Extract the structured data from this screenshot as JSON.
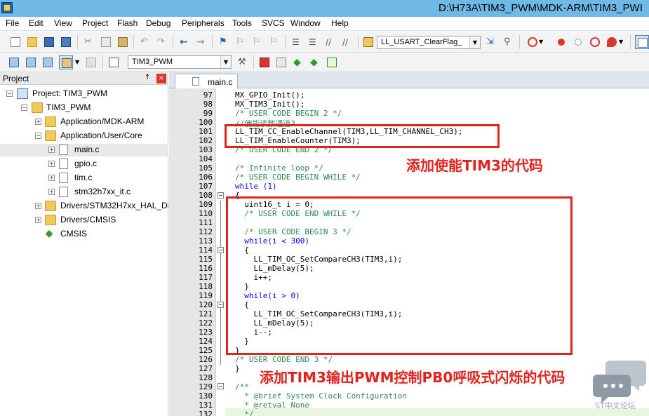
{
  "window": {
    "title": "D:\\H73A\\TIM3_PWM\\MDK-ARM\\TIM3_PWI"
  },
  "menu": [
    "File",
    "Edit",
    "View",
    "Project",
    "Flash",
    "Debug",
    "Peripherals",
    "Tools",
    "SVCS",
    "Window",
    "Help"
  ],
  "toolbar": {
    "find_combo": "LL_USART_ClearFlag_",
    "target_combo": "TIM3_PWM"
  },
  "project_pane": {
    "title": "Project",
    "pin": "↑",
    "close": "×",
    "tree": [
      {
        "label": "Project: TIM3_PWM",
        "expander": "−"
      },
      {
        "label": "TIM3_PWM",
        "expander": "−"
      },
      {
        "label": "Application/MDK-ARM",
        "expander": "+"
      },
      {
        "label": "Application/User/Core",
        "expander": "−"
      },
      {
        "label": "main.c",
        "expander": "+"
      },
      {
        "label": "gpio.c",
        "expander": "+"
      },
      {
        "label": "tim.c",
        "expander": "+"
      },
      {
        "label": "stm32h7xx_it.c",
        "expander": "+"
      },
      {
        "label": "Drivers/STM32H7xx_HAL_Dri",
        "expander": "+"
      },
      {
        "label": "Drivers/CMSIS",
        "expander": "+"
      },
      {
        "label": "CMSIS",
        "expander": ""
      }
    ]
  },
  "editor": {
    "tab": "main.c",
    "lines": [
      {
        "num": "97",
        "text": "MX_GPIO_Init();",
        "color": "#000000"
      },
      {
        "num": "98",
        "text": "MX_TIM3_Init();",
        "color": "#000000"
      },
      {
        "num": "99",
        "text": "/* USER CODE BEGIN 2 */",
        "color": "#2e8b57"
      },
      {
        "num": "100",
        "text": "//使能读数通道3",
        "color": "#2e8b57"
      },
      {
        "num": "101",
        "text": "LL_TIM_CC_EnableChannel(TIM3,LL_TIM_CHANNEL_CH3);",
        "color": "#000000"
      },
      {
        "num": "102",
        "text": "LL_TIM_EnableCounter(TIM3);",
        "color": "#000000"
      },
      {
        "num": "103",
        "text": "/* USER CODE END 2 */",
        "color": "#2e8b57"
      },
      {
        "num": "104",
        "text": "",
        "color": "#000000"
      },
      {
        "num": "105",
        "text": "/* Infinite loop */",
        "color": "#2e8b57"
      },
      {
        "num": "106",
        "text": "/* USER CODE BEGIN WHILE */",
        "color": "#2e8b57"
      },
      {
        "num": "107",
        "text": "while (1)",
        "color": "#0000ff"
      },
      {
        "num": "108",
        "text": "{",
        "color": "#000000"
      },
      {
        "num": "109",
        "text": "  uint16_t i = 0;",
        "color": "#000000"
      },
      {
        "num": "110",
        "text": "  /* USER CODE END WHILE */",
        "color": "#2e8b57"
      },
      {
        "num": "111",
        "text": "",
        "color": "#000000"
      },
      {
        "num": "112",
        "text": "  /* USER CODE BEGIN 3 */",
        "color": "#2e8b57"
      },
      {
        "num": "113",
        "text": "  while(i < 300)",
        "color": "#0000ff"
      },
      {
        "num": "114",
        "text": "  {",
        "color": "#000000"
      },
      {
        "num": "115",
        "text": "    LL_TIM_OC_SetCompareCH3(TIM3,i);",
        "color": "#000000"
      },
      {
        "num": "116",
        "text": "    LL_mDelay(5);",
        "color": "#000000"
      },
      {
        "num": "117",
        "text": "    i++;",
        "color": "#000000"
      },
      {
        "num": "118",
        "text": "  }",
        "color": "#000000"
      },
      {
        "num": "119",
        "text": "  while(i > 0)",
        "color": "#0000ff"
      },
      {
        "num": "120",
        "text": "  {",
        "color": "#000000"
      },
      {
        "num": "121",
        "text": "    LL_TIM_OC_SetCompareCH3(TIM3,i);",
        "color": "#000000"
      },
      {
        "num": "122",
        "text": "    LL_mDelay(5);",
        "color": "#000000"
      },
      {
        "num": "123",
        "text": "    i--;",
        "color": "#000000"
      },
      {
        "num": "124",
        "text": "  }",
        "color": "#000000"
      },
      {
        "num": "125",
        "text": "}",
        "color": "#000000"
      },
      {
        "num": "126",
        "text": "/* USER CODE END 3 */",
        "color": "#2e8b57"
      },
      {
        "num": "127",
        "text": "}",
        "color": "#000000"
      },
      {
        "num": "128",
        "text": "",
        "color": "#000000"
      },
      {
        "num": "129",
        "text": "/**",
        "color": "#2e8b57"
      },
      {
        "num": "130",
        "text": "  * @brief System Clock Configuration",
        "color": "#2e8b57"
      },
      {
        "num": "131",
        "text": "  * @retval None",
        "color": "#2e8b57"
      },
      {
        "num": "132",
        "text": "  */",
        "color": "#2e8b57"
      }
    ]
  },
  "annotations": {
    "first": "添加使能TIM3的代码",
    "second": "添加TIM3输出PWM控制PB0呼吸式闪烁的代码"
  },
  "watermark": "ST中文论坛",
  "colors": {
    "annotation": "#e0231c",
    "comment": "#2e8b57",
    "keyword": "#0000ff",
    "titlebar": "#6fb9e6"
  }
}
